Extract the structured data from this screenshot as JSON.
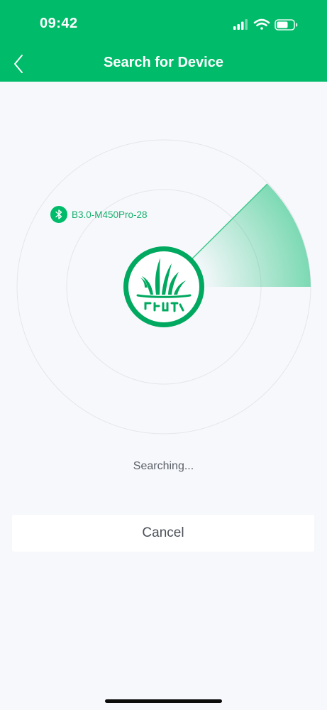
{
  "status_bar": {
    "time": "09:42",
    "icons": [
      "cellular-signal-icon",
      "wifi-icon",
      "battery-icon"
    ]
  },
  "nav": {
    "title": "Search for Device",
    "back_icon": "chevron-left-icon"
  },
  "radar": {
    "device": {
      "icon": "bluetooth-icon",
      "name": "B3.0-M450Pro-28"
    },
    "logo_icon": "grass-logo-icon"
  },
  "status_text": "Searching...",
  "actions": {
    "cancel_label": "Cancel"
  },
  "colors": {
    "brand_green": "#00bb6a",
    "background": "#f7f8fc",
    "ring": "#e4e6ea"
  }
}
